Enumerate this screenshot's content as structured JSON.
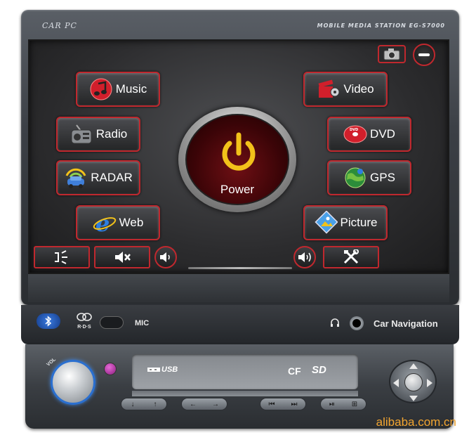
{
  "device": {
    "brand_left": "CAR PC",
    "brand_right": "MOBILE MEDIA STATION  EG-S7000"
  },
  "screen": {
    "top_icons": [
      "camera-icon",
      "minimize-icon"
    ],
    "apps_left": [
      {
        "label": "Music",
        "icon": "music-icon"
      },
      {
        "label": "Radio",
        "icon": "radio-icon"
      },
      {
        "label": "RADAR",
        "icon": "radar-icon"
      },
      {
        "label": "Web",
        "icon": "web-browser-icon"
      }
    ],
    "apps_right": [
      {
        "label": "Video",
        "icon": "video-icon"
      },
      {
        "label": "DVD",
        "icon": "dvd-icon"
      },
      {
        "label": "GPS",
        "icon": "gps-globe-icon"
      },
      {
        "label": "Picture",
        "icon": "picture-icon"
      }
    ],
    "power_label": "Power",
    "controls": [
      "eq-icon",
      "mute-icon",
      "volume-down-icon",
      "volume-up-icon",
      "settings-tools-icon"
    ]
  },
  "strip": {
    "mic_label": "MIC",
    "nav_label": "Car Navigation",
    "rds_label": "R·D·S"
  },
  "faceplate": {
    "vol_label": "VOL",
    "usb_label": "USB",
    "cf_label": "CF",
    "sd_label": "SD"
  },
  "watermark": "alibaba.com.cn",
  "colors": {
    "accent_red": "#c0282e",
    "power_yellow": "#f2c21a",
    "watermark_orange": "#f2a531",
    "knob_glow": "#2a6fd0"
  }
}
